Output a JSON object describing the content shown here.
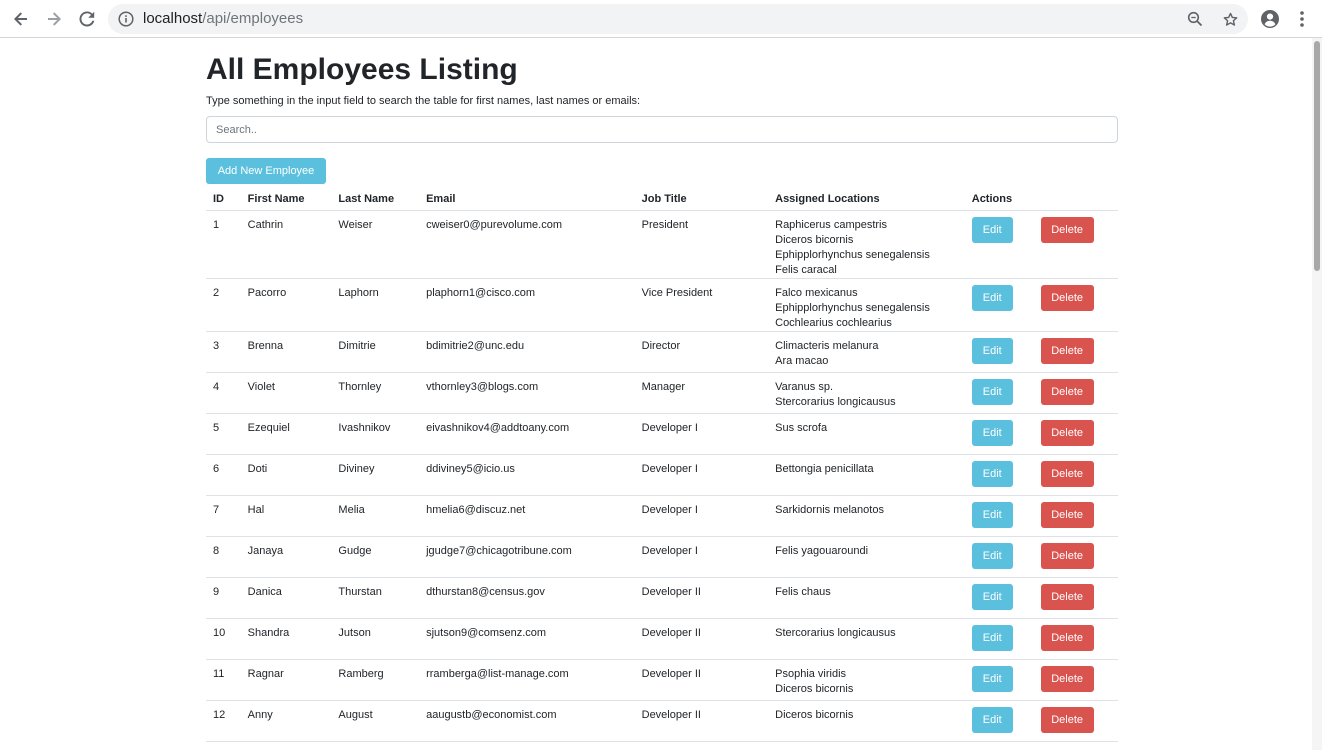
{
  "browser": {
    "url_host": "localhost",
    "url_path": "/api/employees"
  },
  "page": {
    "title": "All Employees Listing",
    "instructions": "Type something in the input field to search the table for first names, last names or emails:",
    "search_placeholder": "Search..",
    "add_button": "Add New Employee"
  },
  "table": {
    "headers": {
      "id": "ID",
      "first": "First Name",
      "last": "Last Name",
      "email": "Email",
      "job": "Job Title",
      "locations": "Assigned Locations",
      "actions": "Actions"
    },
    "edit_label": "Edit",
    "delete_label": "Delete",
    "rows": [
      {
        "id": "1",
        "first": "Cathrin",
        "last": "Weiser",
        "email": "cweiser0@purevolume.com",
        "job": "President",
        "locations": [
          "Raphicerus campestris",
          "Diceros bicornis",
          "Ephipplorhynchus senegalensis",
          "Felis caracal"
        ]
      },
      {
        "id": "2",
        "first": "Pacorro",
        "last": "Laphorn",
        "email": "plaphorn1@cisco.com",
        "job": "Vice President",
        "locations": [
          "Falco mexicanus",
          "Ephipplorhynchus senegalensis",
          "Cochlearius cochlearius"
        ]
      },
      {
        "id": "3",
        "first": "Brenna",
        "last": "Dimitrie",
        "email": "bdimitrie2@unc.edu",
        "job": "Director",
        "locations": [
          "Climacteris melanura",
          "Ara macao"
        ]
      },
      {
        "id": "4",
        "first": "Violet",
        "last": "Thornley",
        "email": "vthornley3@blogs.com",
        "job": "Manager",
        "locations": [
          "Varanus sp.",
          "Stercorarius longicausus"
        ]
      },
      {
        "id": "5",
        "first": "Ezequiel",
        "last": "Ivashnikov",
        "email": "eivashnikov4@addtoany.com",
        "job": "Developer I",
        "locations": [
          "Sus scrofa"
        ]
      },
      {
        "id": "6",
        "first": "Doti",
        "last": "Diviney",
        "email": "ddiviney5@icio.us",
        "job": "Developer I",
        "locations": [
          "Bettongia penicillata"
        ]
      },
      {
        "id": "7",
        "first": "Hal",
        "last": "Melia",
        "email": "hmelia6@discuz.net",
        "job": "Developer I",
        "locations": [
          "Sarkidornis melanotos"
        ]
      },
      {
        "id": "8",
        "first": "Janaya",
        "last": "Gudge",
        "email": "jgudge7@chicagotribune.com",
        "job": "Developer I",
        "locations": [
          "Felis yagouaroundi"
        ]
      },
      {
        "id": "9",
        "first": "Danica",
        "last": "Thurstan",
        "email": "dthurstan8@census.gov",
        "job": "Developer II",
        "locations": [
          "Felis chaus"
        ]
      },
      {
        "id": "10",
        "first": "Shandra",
        "last": "Jutson",
        "email": "sjutson9@comsenz.com",
        "job": "Developer II",
        "locations": [
          "Stercorarius longicausus"
        ]
      },
      {
        "id": "11",
        "first": "Ragnar",
        "last": "Ramberg",
        "email": "rramberga@list-manage.com",
        "job": "Developer II",
        "locations": [
          "Psophia viridis",
          "Diceros bicornis"
        ]
      },
      {
        "id": "12",
        "first": "Anny",
        "last": "August",
        "email": "aaugustb@economist.com",
        "job": "Developer II",
        "locations": [
          "Diceros bicornis"
        ]
      }
    ]
  },
  "colors": {
    "info": "#5bc0de",
    "danger": "#d9534f"
  }
}
